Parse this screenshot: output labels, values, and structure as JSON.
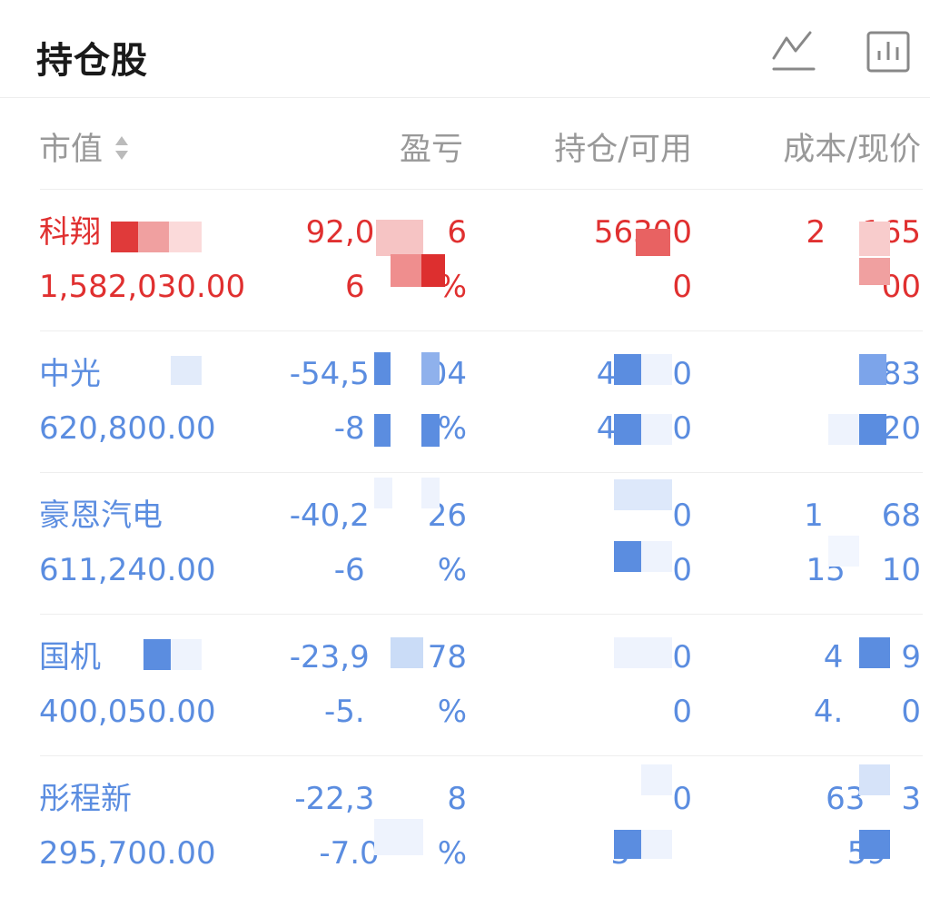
{
  "header": {
    "title": "持仓股",
    "icons": [
      "line-chart-icon",
      "bar-chart-icon"
    ]
  },
  "columns": {
    "market_value": "市值",
    "profit_loss": "盈亏",
    "holding_available": "持仓/可用",
    "cost_price": "成本/现价"
  },
  "colors": {
    "gain": "#e03030",
    "loss": "#5b8de0",
    "header_text": "#999999"
  },
  "rows": [
    {
      "name": "科翔",
      "market_value": "1,582,030.00",
      "pl_amount": "92,0",
      "pl_amount_tail": "6",
      "pl_pct": "6",
      "pl_pct_tail": "%",
      "holding": "56300",
      "available": "0",
      "cost": "2",
      "cost_tail": "165",
      "price": "00",
      "trend": "gain"
    },
    {
      "name": "中光",
      "market_value": "620,800.00",
      "pl_amount": "-54,5",
      "pl_amount_tail": "04",
      "pl_pct": "-8",
      "pl_pct_tail": "%",
      "holding": "4",
      "holding_tail": "0",
      "available": "4",
      "available_tail": "0",
      "cost": "",
      "cost_tail": "83",
      "price": "",
      "price_tail": "20",
      "trend": "loss"
    },
    {
      "name": "豪恩汽电",
      "market_value": "611,240.00",
      "pl_amount": "-40,2",
      "pl_amount_tail": "26",
      "pl_pct": "-6",
      "pl_pct_tail": "%",
      "holding": "",
      "holding_tail": "0",
      "available": "",
      "available_tail": "0",
      "cost": "1",
      "cost_tail": "68",
      "price": "15",
      "price_tail": "10",
      "trend": "loss"
    },
    {
      "name": "国机",
      "market_value": "400,050.00",
      "pl_amount": "-23,9",
      "pl_amount_tail": "78",
      "pl_pct": "-5.",
      "pl_pct_tail": "%",
      "holding": "",
      "holding_tail": "0",
      "available": "",
      "available_tail": "0",
      "cost": "4",
      "cost_tail": "9",
      "price": "4.",
      "price_tail": "0",
      "trend": "loss"
    },
    {
      "name": "彤程新",
      "market_value": "295,700.00",
      "pl_amount": "-22,3",
      "pl_amount_tail": "8",
      "pl_pct": "-7.0",
      "pl_pct_tail": "%",
      "holding": "",
      "holding_tail": "0",
      "available": "5",
      "available_tail": "",
      "cost": "63",
      "cost_tail": "3",
      "price": "59",
      "price_tail": "",
      "trend": "loss"
    }
  ]
}
